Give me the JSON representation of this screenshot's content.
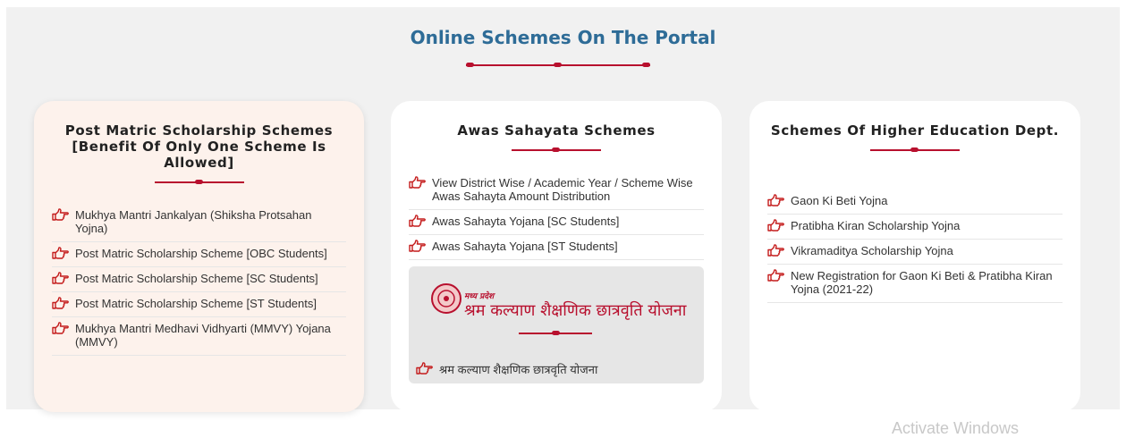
{
  "page": {
    "title": "Online Schemes On The Portal",
    "accent_color": "#b8102e",
    "title_color": "#2e6c97",
    "watermark": "Activate Windows"
  },
  "cards": [
    {
      "title": "Post Matric Scholarship Schemes [Benefit Of Only One Scheme Is Allowed]",
      "items": [
        "Mukhya Mantri Jankalyan (Shiksha Protsahan Yojna)",
        "Post Matric Scholarship Scheme [OBC Students]",
        "Post Matric Scholarship Scheme [SC Students]",
        "Post Matric Scholarship Scheme [ST Students]",
        "Mukhya Mantri Medhavi Vidhyarti (MMVY) Yojana (MMVY)"
      ]
    },
    {
      "title": "Awas Sahayata Schemes",
      "items": [
        "View District Wise / Academic Year / Scheme Wise Awas Sahayta Amount Distribution",
        "Awas Sahayta Yojana [SC Students]",
        "Awas Sahayta Yojana [ST Students]"
      ],
      "banner": {
        "small_text": "मध्य प्रदेश",
        "big_text": "श्रम कल्याण शैक्षणिक छात्रवृति योजना",
        "link": "श्रम कल्याण शैक्षणिक छात्रवृति योजना"
      }
    },
    {
      "title": "Schemes Of Higher Education Dept.",
      "items": [
        "Gaon Ki Beti Yojna",
        "Pratibha Kiran Scholarship Yojna",
        "Vikramaditya Scholarship Yojna",
        "New Registration for Gaon Ki Beti & Pratibha Kiran Yojna (2021-22)"
      ]
    }
  ],
  "icons": {
    "item_icon": "hand-pointing-right-icon"
  }
}
